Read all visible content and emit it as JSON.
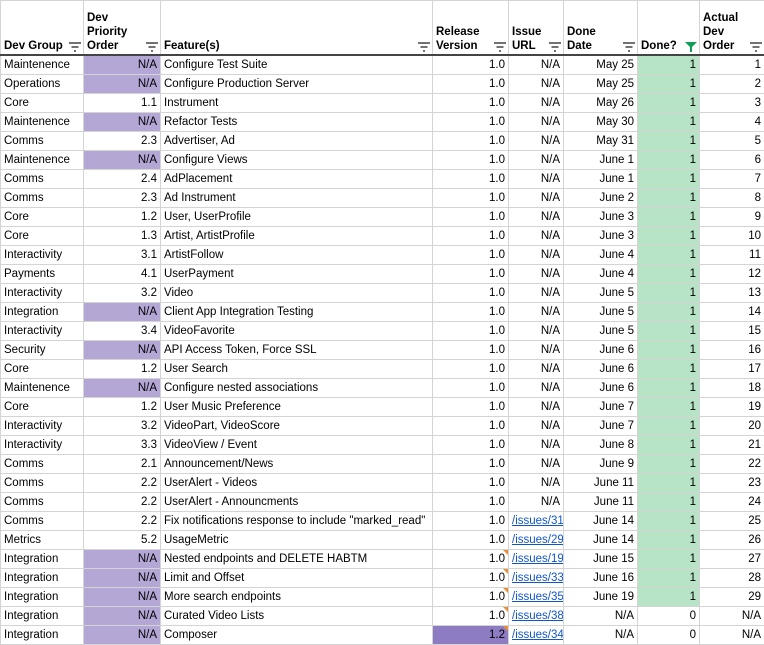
{
  "headers": {
    "dev_group": "Dev Group",
    "dev_priority": "Dev Priority Order",
    "features": "Feature(s)",
    "release_version": "Release Version",
    "issue_url": "Issue URL",
    "done_date": "Done Date",
    "done": "Done?",
    "actual_dev_order": "Actual Dev Order"
  },
  "colors": {
    "na_priority": "#b4a7d6",
    "done_green": "#b7e4c7",
    "release_highlight": "#8e7cc3",
    "link": "#1155cc",
    "active_filter": "#0f9d58"
  },
  "rows": [
    {
      "group": "Maintenence",
      "priority": "N/A",
      "feature": "Configure Test Suite",
      "version": "1.0",
      "url": "N/A",
      "date": "May 25",
      "done": "1",
      "order": "1"
    },
    {
      "group": "Operations",
      "priority": "N/A",
      "feature": "Configure Production Server",
      "version": "1.0",
      "url": "N/A",
      "date": "May 25",
      "done": "1",
      "order": "2"
    },
    {
      "group": "Core",
      "priority": "1.1",
      "feature": "Instrument",
      "version": "1.0",
      "url": "N/A",
      "date": "May 26",
      "done": "1",
      "order": "3"
    },
    {
      "group": "Maintenence",
      "priority": "N/A",
      "feature": "Refactor Tests",
      "version": "1.0",
      "url": "N/A",
      "date": "May 30",
      "done": "1",
      "order": "4"
    },
    {
      "group": "Comms",
      "priority": "2.3",
      "feature": "Advertiser, Ad",
      "version": "1.0",
      "url": "N/A",
      "date": "May 31",
      "done": "1",
      "order": "5"
    },
    {
      "group": "Maintenence",
      "priority": "N/A",
      "feature": "Configure Views",
      "version": "1.0",
      "url": "N/A",
      "date": "June 1",
      "done": "1",
      "order": "6"
    },
    {
      "group": "Comms",
      "priority": "2.4",
      "feature": "AdPlacement",
      "version": "1.0",
      "url": "N/A",
      "date": "June 1",
      "done": "1",
      "order": "7"
    },
    {
      "group": "Comms",
      "priority": "2.3",
      "feature": "Ad Instrument",
      "version": "1.0",
      "url": "N/A",
      "date": "June 2",
      "done": "1",
      "order": "8"
    },
    {
      "group": "Core",
      "priority": "1.2",
      "feature": "User, UserProfile",
      "version": "1.0",
      "url": "N/A",
      "date": "June 3",
      "done": "1",
      "order": "9"
    },
    {
      "group": "Core",
      "priority": "1.3",
      "feature": "Artist, ArtistProfile",
      "version": "1.0",
      "url": "N/A",
      "date": "June 3",
      "done": "1",
      "order": "10"
    },
    {
      "group": "Interactivity",
      "priority": "3.1",
      "feature": "ArtistFollow",
      "version": "1.0",
      "url": "N/A",
      "date": "June 4",
      "done": "1",
      "order": "11"
    },
    {
      "group": "Payments",
      "priority": "4.1",
      "feature": "UserPayment",
      "version": "1.0",
      "url": "N/A",
      "date": "June 4",
      "done": "1",
      "order": "12"
    },
    {
      "group": "Interactivity",
      "priority": "3.2",
      "feature": "Video",
      "version": "1.0",
      "url": "N/A",
      "date": "June 5",
      "done": "1",
      "order": "13"
    },
    {
      "group": "Integration",
      "priority": "N/A",
      "feature": "Client App Integration Testing",
      "version": "1.0",
      "url": "N/A",
      "date": "June 5",
      "done": "1",
      "order": "14"
    },
    {
      "group": "Interactivity",
      "priority": "3.4",
      "feature": "VideoFavorite",
      "version": "1.0",
      "url": "N/A",
      "date": "June 5",
      "done": "1",
      "order": "15"
    },
    {
      "group": "Security",
      "priority": "N/A",
      "feature": "API Access Token, Force SSL",
      "version": "1.0",
      "url": "N/A",
      "date": "June 6",
      "done": "1",
      "order": "16"
    },
    {
      "group": "Core",
      "priority": "1.2",
      "feature": "User Search",
      "version": "1.0",
      "url": "N/A",
      "date": "June 6",
      "done": "1",
      "order": "17"
    },
    {
      "group": "Maintenence",
      "priority": "N/A",
      "feature": "Configure nested associations",
      "version": "1.0",
      "url": "N/A",
      "date": "June 6",
      "done": "1",
      "order": "18"
    },
    {
      "group": "Core",
      "priority": "1.2",
      "feature": "User Music Preference",
      "version": "1.0",
      "url": "N/A",
      "date": "June 7",
      "done": "1",
      "order": "19"
    },
    {
      "group": "Interactivity",
      "priority": "3.2",
      "feature": "VideoPart, VideoScore",
      "version": "1.0",
      "url": "N/A",
      "date": "June 7",
      "done": "1",
      "order": "20"
    },
    {
      "group": "Interactivity",
      "priority": "3.3",
      "feature": "VideoView / Event",
      "version": "1.0",
      "url": "N/A",
      "date": "June 8",
      "done": "1",
      "order": "21"
    },
    {
      "group": "Comms",
      "priority": "2.1",
      "feature": "Announcement/News",
      "version": "1.0",
      "url": "N/A",
      "date": "June 9",
      "done": "1",
      "order": "22"
    },
    {
      "group": "Comms",
      "priority": "2.2",
      "feature": "UserAlert - Videos",
      "version": "1.0",
      "url": "N/A",
      "date": "June 11",
      "done": "1",
      "order": "23"
    },
    {
      "group": "Comms",
      "priority": "2.2",
      "feature": "UserAlert - Announcments",
      "version": "1.0",
      "url": "N/A",
      "date": "June 11",
      "done": "1",
      "order": "24"
    },
    {
      "group": "Comms",
      "priority": "2.2",
      "feature": "Fix notifications response to include \"marked_read\"",
      "version": "1.0",
      "url": "/issues/31",
      "date": "June 14",
      "done": "1",
      "order": "25"
    },
    {
      "group": "Metrics",
      "priority": "5.2",
      "feature": "UsageMetric",
      "version": "1.0",
      "url": "/issues/29",
      "date": "June 14",
      "done": "1",
      "order": "26"
    },
    {
      "group": "Integration",
      "priority": "N/A",
      "feature": "Nested endpoints and DELETE HABTM",
      "version": "1.0",
      "url": "/issues/19",
      "date": "June 15",
      "done": "1",
      "order": "27"
    },
    {
      "group": "Integration",
      "priority": "N/A",
      "feature": "Limit and Offset",
      "version": "1.0",
      "url": "/issues/33",
      "date": "June 16",
      "done": "1",
      "order": "28"
    },
    {
      "group": "Integration",
      "priority": "N/A",
      "feature": "More search endpoints",
      "version": "1.0",
      "url": "/issues/35",
      "date": "June 19",
      "done": "1",
      "order": "29"
    },
    {
      "group": "Integration",
      "priority": "N/A",
      "feature": "Curated Video Lists",
      "version": "1.0",
      "url": "/issues/38",
      "date": "N/A",
      "done": "0",
      "order": "N/A"
    },
    {
      "group": "Integration",
      "priority": "N/A",
      "feature": "Composer",
      "version": "1.2",
      "url": "/issues/34",
      "date": "N/A",
      "done": "0",
      "order": "N/A"
    }
  ]
}
